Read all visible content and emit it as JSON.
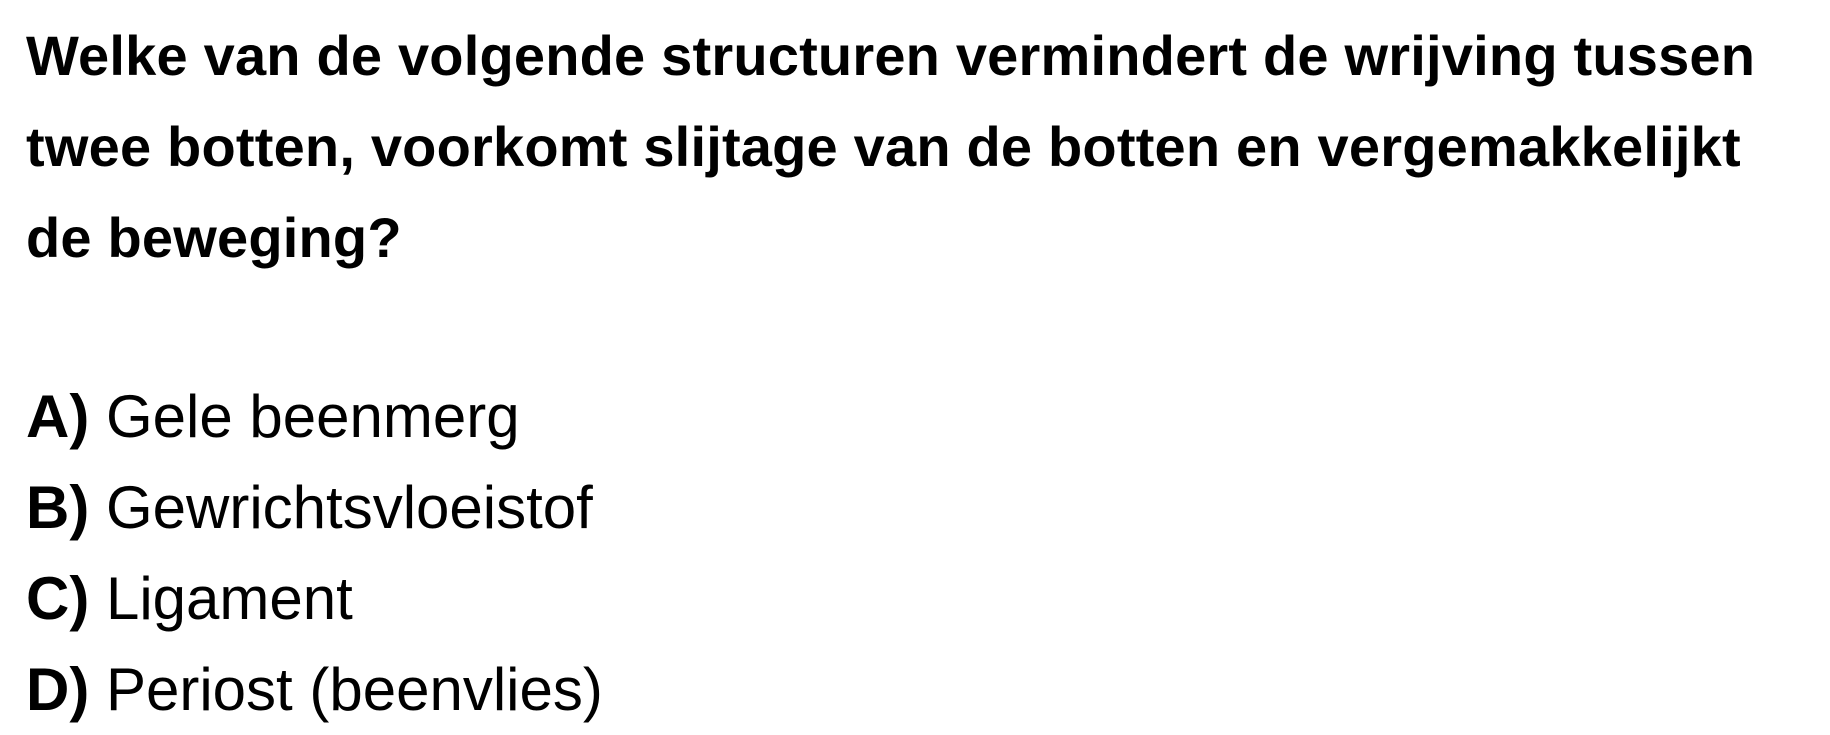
{
  "question": "Welke van de volgende structuren vermindert de wrijving tussen twee botten, voorkomt slijtage van de botten en vergemakkelijkt de beweging?",
  "options": [
    {
      "letter": "A)",
      "text": "Gele beenmerg"
    },
    {
      "letter": "B)",
      "text": "Gewrichtsvloeistof"
    },
    {
      "letter": "C)",
      "text": "Ligament"
    },
    {
      "letter": "D)",
      "text": "Periost (beenvlies)"
    }
  ]
}
